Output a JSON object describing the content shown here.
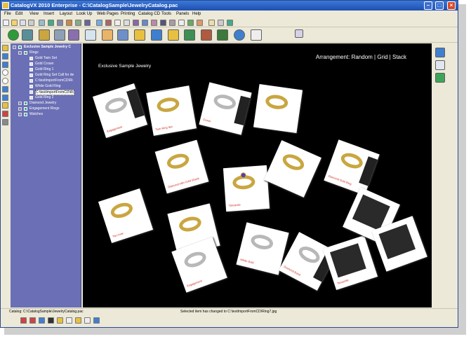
{
  "window": {
    "title": "CatalogVX 2010 Enterprise - C:\\CatalogSample\\JewelryCatalog.pac"
  },
  "menu": [
    "File",
    "Edit",
    "View",
    "Insert",
    "Layout",
    "Look Up",
    "Web Pages",
    "Printing",
    "Catalog CD",
    "Tools",
    "Panels",
    "Help"
  ],
  "tree": {
    "root": "Exclusive Sample Jewelry C",
    "rings": "Rings",
    "ring_items": [
      "Gold Twin Set",
      "Gold Crown",
      "Gold Ring 1",
      "Gold Ring Set Call for de",
      "C:\\testImportFromCD\\Ri",
      "White Gold Ring",
      "C:\\testImportFromCD\\Ri",
      "Gold Ring 2"
    ],
    "selected_index": 6,
    "other_groups": [
      "Diamond Jewelry",
      "Engagement Rings",
      "Watches"
    ]
  },
  "canvas": {
    "arrangement": "Arrangement:  Random | Grid | Stack",
    "catalog_title": "Exclusive  Sample Jewelry"
  },
  "cards": [
    "Engagement",
    "Twin Ring Set",
    "Crown",
    "",
    "Diamond with Gold Shank",
    "Tanzanite",
    "",
    "Diamond Gold Ring",
    "Two tone",
    "Gold Twin Ring",
    "Engagement",
    "White Gold",
    "Diamond Band",
    "Tanzanite",
    "",
    ""
  ],
  "status": {
    "left": "Catalog: C:\\CatalogSample\\JewelryCatalog.pac",
    "right": "Selected item has changed to C:\\testImportFromCD\\Ring7.jpg"
  }
}
